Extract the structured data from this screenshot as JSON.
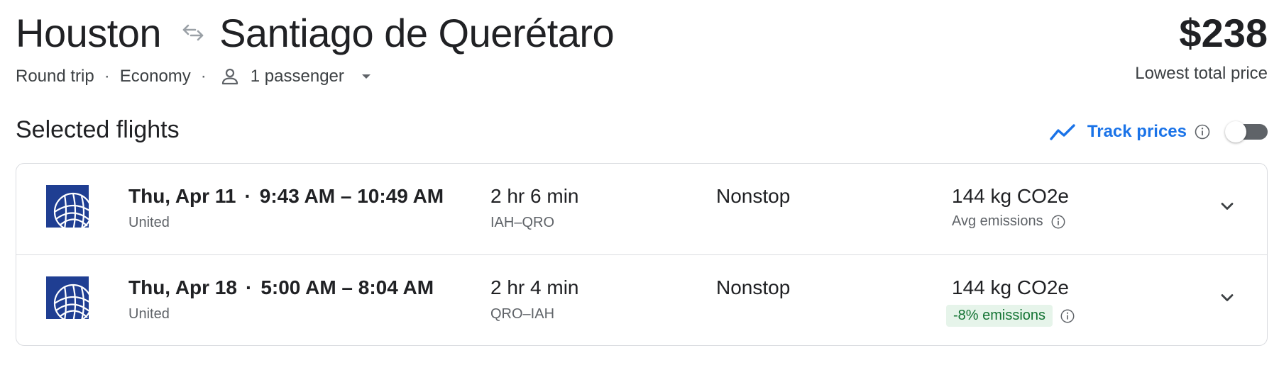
{
  "header": {
    "origin": "Houston",
    "destination": "Santiago de Querétaro",
    "swap_icon": "swap-arrows-icon",
    "price": "$238",
    "price_caption": "Lowest total price"
  },
  "trip": {
    "type": "Round trip",
    "cabin": "Economy",
    "passengers": "1 passenger"
  },
  "section": {
    "title": "Selected flights",
    "track_label": "Track prices",
    "track_enabled": false
  },
  "flights": [
    {
      "date": "Thu, Apr 11",
      "time_range": "9:43 AM – 10:49 AM",
      "airline": "United",
      "duration": "2 hr 6 min",
      "route": "IAH–QRO",
      "stops": "Nonstop",
      "emissions": "144 kg CO2e",
      "emissions_note": "Avg emissions"
    },
    {
      "date": "Thu, Apr 18",
      "time_range": "5:00 AM – 8:04 AM",
      "airline": "United",
      "duration": "2 hr 4 min",
      "route": "QRO–IAH",
      "stops": "Nonstop",
      "emissions": "144 kg CO2e",
      "emissions_note": "-8% emissions"
    }
  ],
  "colors": {
    "accent": "#1a73e8",
    "text": "#202124",
    "secondary_text": "#5f6368",
    "airline_blue": "#1f3e92",
    "emission_badge_bg": "#e6f4ea",
    "emission_badge_text": "#137333",
    "border": "#dadce0"
  }
}
